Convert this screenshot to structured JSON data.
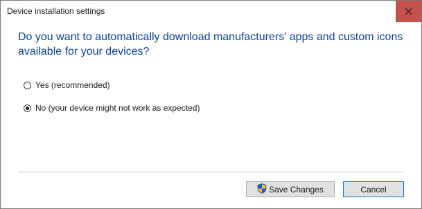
{
  "window": {
    "title": "Device installation settings"
  },
  "dialog": {
    "question": "Do you want to automatically download manufacturers' apps and custom icons available for your devices?",
    "options": [
      {
        "label": "Yes (recommended)",
        "selected": false
      },
      {
        "label": "No (your device might not work as expected)",
        "selected": true
      }
    ]
  },
  "buttons": {
    "save_label": "Save Changes",
    "cancel_label": "Cancel"
  },
  "icons": {
    "close": "close-icon",
    "shield": "uac-shield-icon"
  },
  "colors": {
    "question_text": "#0a3fa8",
    "close_button_bg": "#c7504a",
    "button_focus_border": "#0078d7"
  }
}
